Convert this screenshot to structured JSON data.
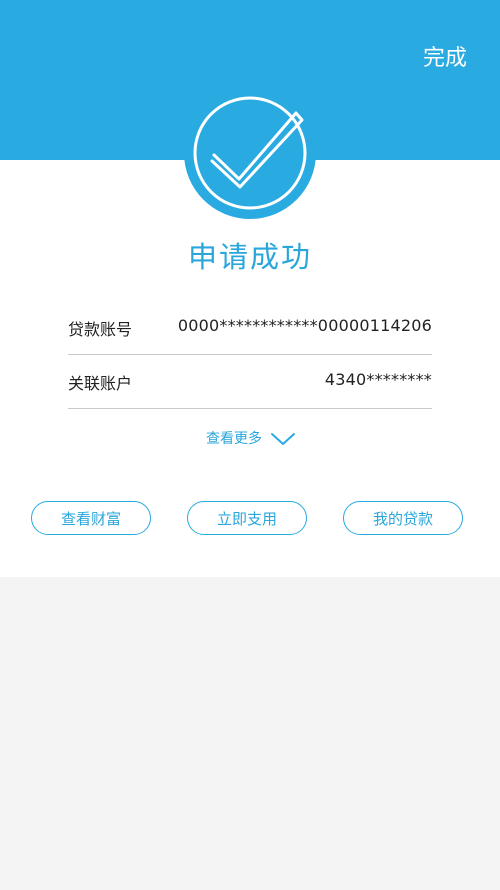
{
  "header": {
    "done_label": "完成",
    "background_color": "#29abe2"
  },
  "status": {
    "icon": "check-circle-icon",
    "title": "申请成功"
  },
  "details": [
    {
      "label": "贷款账号",
      "value": "0000************00000114206"
    },
    {
      "label": "关联账户",
      "value": "4340********"
    }
  ],
  "more": {
    "label": "查看更多",
    "icon": "chevron-down-icon"
  },
  "actions": [
    {
      "label": "查看财富"
    },
    {
      "label": "立即支用"
    },
    {
      "label": "我的贷款"
    }
  ],
  "colors": {
    "accent": "#29abe2",
    "text": "#222222",
    "page_background": "#f5f4f4"
  }
}
